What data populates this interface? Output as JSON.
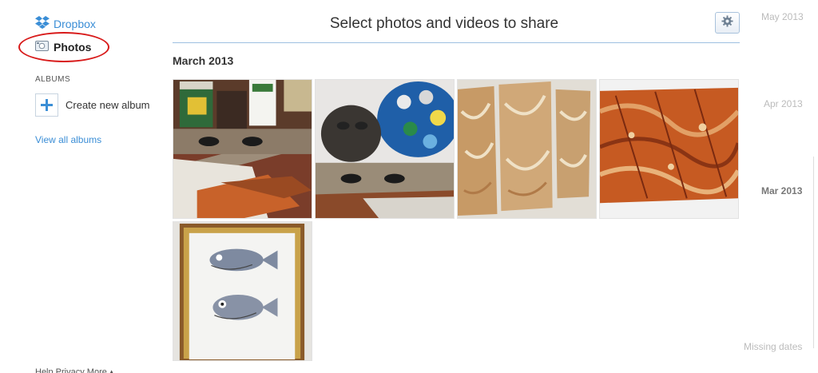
{
  "sidebar": {
    "dropbox_label": "Dropbox",
    "photos_label": "Photos",
    "albums_heading": "ALBUMS",
    "create_album_label": "Create new album",
    "view_all_label": "View all albums",
    "footer_label": "Help  Privacy  More  ▴"
  },
  "header": {
    "title": "Select photos and videos to share",
    "settings_icon": "gear-icon"
  },
  "section": {
    "title": "March 2013"
  },
  "photos": [
    {
      "subject": "paint jars with stencil of eyes and orange sand"
    },
    {
      "subject": "paint palette, clay mask and eyes stencil"
    },
    {
      "subject": "three textured orange panels on wall"
    },
    {
      "subject": "close-up of orange textured surface"
    },
    {
      "subject": "framed drawing of two fish"
    }
  ],
  "timeline": {
    "items": [
      "May 2013",
      "Apr 2013",
      "Mar 2013"
    ],
    "active": "Mar 2013",
    "missing_label": "Missing dates"
  },
  "colors": {
    "link": "#3b8ed6",
    "annotation": "#d81a1a",
    "rule": "#9dc0e0"
  }
}
